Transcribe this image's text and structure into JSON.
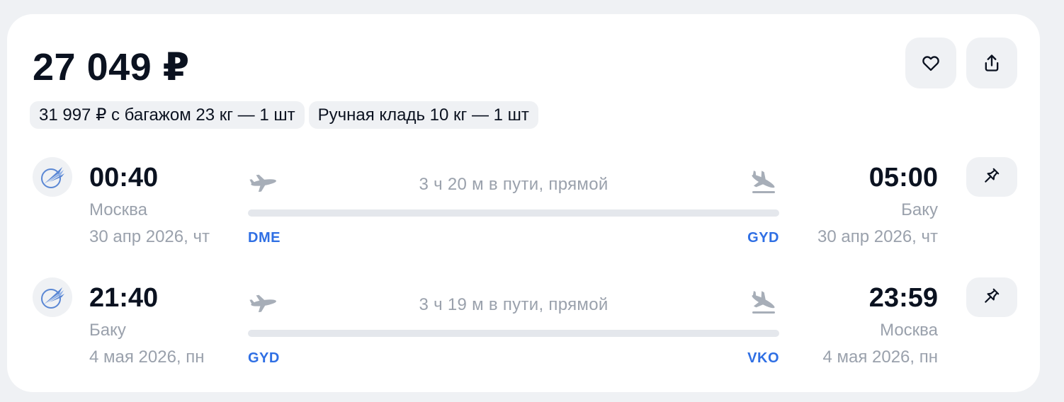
{
  "price": "27 049 ₽",
  "tags": [
    "31 997 ₽ с багажом 23 кг — 1 шт",
    "Ручная кладь 10 кг — 1 шт"
  ],
  "icons": {
    "favorite": "heart-icon",
    "share": "share-icon",
    "pin": "pin-icon",
    "airline": "airline-logo",
    "takeoff": "plane-takeoff-icon",
    "landing": "plane-landing-icon"
  },
  "colors": {
    "accent": "#2F6FE4",
    "muted_text": "#9AA1AC",
    "background": "#EFF1F4"
  },
  "segments": [
    {
      "dep_time": "00:40",
      "dep_city": "Москва",
      "dep_date": "30 апр 2026, чт",
      "dep_code": "DME",
      "duration": "3 ч 20 м в пути, прямой",
      "arr_time": "05:00",
      "arr_city": "Баку",
      "arr_date": "30 апр 2026, чт",
      "arr_code": "GYD"
    },
    {
      "dep_time": "21:40",
      "dep_city": "Баку",
      "dep_date": "4 мая 2026, пн",
      "dep_code": "GYD",
      "duration": "3 ч 19 м в пути, прямой",
      "arr_time": "23:59",
      "arr_city": "Москва",
      "arr_date": "4 мая 2026, пн",
      "arr_code": "VKO"
    }
  ]
}
